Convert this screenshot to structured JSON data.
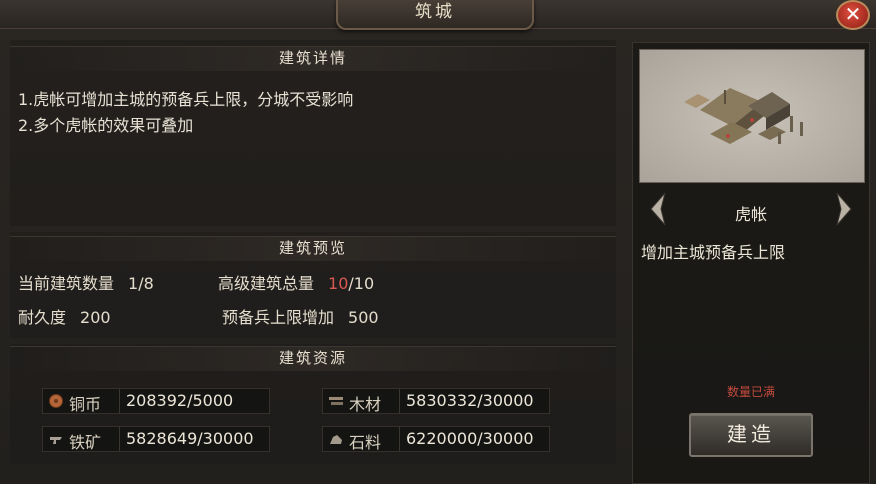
{
  "window": {
    "title": "筑城",
    "close": "✕"
  },
  "details": {
    "header": "建筑详情",
    "lines": [
      "1.虎帐可增加主城的预备兵上限，分城不受影响",
      "2.多个虎帐的效果可叠加"
    ]
  },
  "preview": {
    "header": "建筑预览",
    "current_count_label": "当前建筑数量",
    "current_count_value": "1/8",
    "advanced_total_label": "高级建筑总量",
    "advanced_total_current": "10",
    "advanced_total_max": "/10",
    "durability_label": "耐久度",
    "durability_value": "200",
    "reserve_label": "预备兵上限增加",
    "reserve_value": "500"
  },
  "resources": {
    "header": "建筑资源",
    "items": [
      {
        "icon": "copper-coin-icon",
        "name": "铜币",
        "value": "208392/5000"
      },
      {
        "icon": "wood-icon",
        "name": "木材",
        "value": "5830332/30000"
      },
      {
        "icon": "iron-ore-icon",
        "name": "铁矿",
        "value": "5828649/30000"
      },
      {
        "icon": "stone-icon",
        "name": "石料",
        "value": "6220000/30000"
      }
    ]
  },
  "building": {
    "name": "虎帐",
    "effect": "增加主城预备兵上限",
    "status": "数量已满",
    "build_label": "建造"
  },
  "colors": {
    "accent_red": "#d85a50",
    "status_red": "#c44a3e"
  }
}
